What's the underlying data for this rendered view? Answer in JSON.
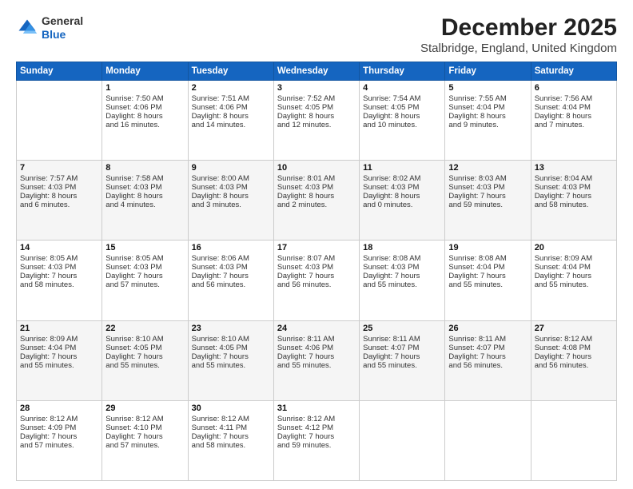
{
  "logo": {
    "general": "General",
    "blue": "Blue"
  },
  "title": "December 2025",
  "subtitle": "Stalbridge, England, United Kingdom",
  "headers": [
    "Sunday",
    "Monday",
    "Tuesday",
    "Wednesday",
    "Thursday",
    "Friday",
    "Saturday"
  ],
  "weeks": [
    [
      {
        "day": "",
        "lines": []
      },
      {
        "day": "1",
        "lines": [
          "Sunrise: 7:50 AM",
          "Sunset: 4:06 PM",
          "Daylight: 8 hours",
          "and 16 minutes."
        ]
      },
      {
        "day": "2",
        "lines": [
          "Sunrise: 7:51 AM",
          "Sunset: 4:06 PM",
          "Daylight: 8 hours",
          "and 14 minutes."
        ]
      },
      {
        "day": "3",
        "lines": [
          "Sunrise: 7:52 AM",
          "Sunset: 4:05 PM",
          "Daylight: 8 hours",
          "and 12 minutes."
        ]
      },
      {
        "day": "4",
        "lines": [
          "Sunrise: 7:54 AM",
          "Sunset: 4:05 PM",
          "Daylight: 8 hours",
          "and 10 minutes."
        ]
      },
      {
        "day": "5",
        "lines": [
          "Sunrise: 7:55 AM",
          "Sunset: 4:04 PM",
          "Daylight: 8 hours",
          "and 9 minutes."
        ]
      },
      {
        "day": "6",
        "lines": [
          "Sunrise: 7:56 AM",
          "Sunset: 4:04 PM",
          "Daylight: 8 hours",
          "and 7 minutes."
        ]
      }
    ],
    [
      {
        "day": "7",
        "lines": [
          "Sunrise: 7:57 AM",
          "Sunset: 4:03 PM",
          "Daylight: 8 hours",
          "and 6 minutes."
        ]
      },
      {
        "day": "8",
        "lines": [
          "Sunrise: 7:58 AM",
          "Sunset: 4:03 PM",
          "Daylight: 8 hours",
          "and 4 minutes."
        ]
      },
      {
        "day": "9",
        "lines": [
          "Sunrise: 8:00 AM",
          "Sunset: 4:03 PM",
          "Daylight: 8 hours",
          "and 3 minutes."
        ]
      },
      {
        "day": "10",
        "lines": [
          "Sunrise: 8:01 AM",
          "Sunset: 4:03 PM",
          "Daylight: 8 hours",
          "and 2 minutes."
        ]
      },
      {
        "day": "11",
        "lines": [
          "Sunrise: 8:02 AM",
          "Sunset: 4:03 PM",
          "Daylight: 8 hours",
          "and 0 minutes."
        ]
      },
      {
        "day": "12",
        "lines": [
          "Sunrise: 8:03 AM",
          "Sunset: 4:03 PM",
          "Daylight: 7 hours",
          "and 59 minutes."
        ]
      },
      {
        "day": "13",
        "lines": [
          "Sunrise: 8:04 AM",
          "Sunset: 4:03 PM",
          "Daylight: 7 hours",
          "and 58 minutes."
        ]
      }
    ],
    [
      {
        "day": "14",
        "lines": [
          "Sunrise: 8:05 AM",
          "Sunset: 4:03 PM",
          "Daylight: 7 hours",
          "and 58 minutes."
        ]
      },
      {
        "day": "15",
        "lines": [
          "Sunrise: 8:05 AM",
          "Sunset: 4:03 PM",
          "Daylight: 7 hours",
          "and 57 minutes."
        ]
      },
      {
        "day": "16",
        "lines": [
          "Sunrise: 8:06 AM",
          "Sunset: 4:03 PM",
          "Daylight: 7 hours",
          "and 56 minutes."
        ]
      },
      {
        "day": "17",
        "lines": [
          "Sunrise: 8:07 AM",
          "Sunset: 4:03 PM",
          "Daylight: 7 hours",
          "and 56 minutes."
        ]
      },
      {
        "day": "18",
        "lines": [
          "Sunrise: 8:08 AM",
          "Sunset: 4:03 PM",
          "Daylight: 7 hours",
          "and 55 minutes."
        ]
      },
      {
        "day": "19",
        "lines": [
          "Sunrise: 8:08 AM",
          "Sunset: 4:04 PM",
          "Daylight: 7 hours",
          "and 55 minutes."
        ]
      },
      {
        "day": "20",
        "lines": [
          "Sunrise: 8:09 AM",
          "Sunset: 4:04 PM",
          "Daylight: 7 hours",
          "and 55 minutes."
        ]
      }
    ],
    [
      {
        "day": "21",
        "lines": [
          "Sunrise: 8:09 AM",
          "Sunset: 4:04 PM",
          "Daylight: 7 hours",
          "and 55 minutes."
        ]
      },
      {
        "day": "22",
        "lines": [
          "Sunrise: 8:10 AM",
          "Sunset: 4:05 PM",
          "Daylight: 7 hours",
          "and 55 minutes."
        ]
      },
      {
        "day": "23",
        "lines": [
          "Sunrise: 8:10 AM",
          "Sunset: 4:05 PM",
          "Daylight: 7 hours",
          "and 55 minutes."
        ]
      },
      {
        "day": "24",
        "lines": [
          "Sunrise: 8:11 AM",
          "Sunset: 4:06 PM",
          "Daylight: 7 hours",
          "and 55 minutes."
        ]
      },
      {
        "day": "25",
        "lines": [
          "Sunrise: 8:11 AM",
          "Sunset: 4:07 PM",
          "Daylight: 7 hours",
          "and 55 minutes."
        ]
      },
      {
        "day": "26",
        "lines": [
          "Sunrise: 8:11 AM",
          "Sunset: 4:07 PM",
          "Daylight: 7 hours",
          "and 56 minutes."
        ]
      },
      {
        "day": "27",
        "lines": [
          "Sunrise: 8:12 AM",
          "Sunset: 4:08 PM",
          "Daylight: 7 hours",
          "and 56 minutes."
        ]
      }
    ],
    [
      {
        "day": "28",
        "lines": [
          "Sunrise: 8:12 AM",
          "Sunset: 4:09 PM",
          "Daylight: 7 hours",
          "and 57 minutes."
        ]
      },
      {
        "day": "29",
        "lines": [
          "Sunrise: 8:12 AM",
          "Sunset: 4:10 PM",
          "Daylight: 7 hours",
          "and 57 minutes."
        ]
      },
      {
        "day": "30",
        "lines": [
          "Sunrise: 8:12 AM",
          "Sunset: 4:11 PM",
          "Daylight: 7 hours",
          "and 58 minutes."
        ]
      },
      {
        "day": "31",
        "lines": [
          "Sunrise: 8:12 AM",
          "Sunset: 4:12 PM",
          "Daylight: 7 hours",
          "and 59 minutes."
        ]
      },
      {
        "day": "",
        "lines": []
      },
      {
        "day": "",
        "lines": []
      },
      {
        "day": "",
        "lines": []
      }
    ]
  ]
}
